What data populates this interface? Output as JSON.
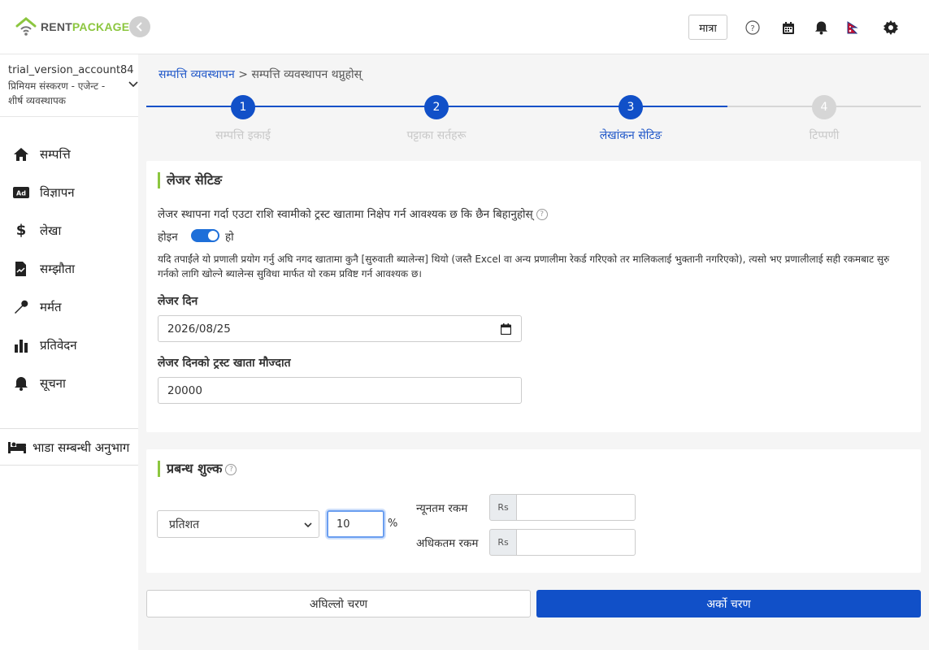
{
  "brand": {
    "part1": "RENT",
    "part2": "PACKAGE"
  },
  "account": {
    "name": "trial_version_account84",
    "plan": "प्रिमियम संस्करण - एजेन्ट - शीर्ष व्यवस्थापक"
  },
  "sidebar": {
    "items": [
      {
        "label": "सम्पत्ति",
        "icon": "home-icon"
      },
      {
        "label": "विज्ञापन",
        "icon": "ad-icon"
      },
      {
        "label": "लेखा",
        "icon": "dollar-icon"
      },
      {
        "label": "सम्झौता",
        "icon": "contract-icon"
      },
      {
        "label": "मर्मत",
        "icon": "wrench-icon"
      },
      {
        "label": "प्रतिवेदन",
        "icon": "bar-chart-icon"
      },
      {
        "label": "सूचना",
        "icon": "bell-icon"
      }
    ],
    "rental_section": "भाडा सम्बन्धी अनुभाग"
  },
  "topbar": {
    "matra_label": "मात्रा",
    "icons": [
      "help-icon",
      "calendar-icon",
      "bell-icon",
      "nepal-flag-icon",
      "gear-icon"
    ]
  },
  "breadcrumb": {
    "parent": "सम्पत्ति व्यवस्थापन",
    "separator": ">",
    "current": "सम्पत्ति व्यवस्थापन थप्नुहोस्"
  },
  "steps": [
    {
      "number": "1",
      "label": "सम्पत्ति इकाई",
      "state": "done"
    },
    {
      "number": "2",
      "label": "पट्टाका सर्तहरू",
      "state": "done"
    },
    {
      "number": "3",
      "label": "लेखांकन सेटिङ",
      "state": "active"
    },
    {
      "number": "4",
      "label": "टिप्पणी",
      "state": "pending"
    }
  ],
  "ledger": {
    "title": "लेजर सेटिङ",
    "question": "लेजर स्थापना गर्दा एउटा राशि स्वामीको ट्रस्ट खातामा निक्षेप गर्न आवश्यक छ कि छैन बिहानुहोस्",
    "toggle_no": "होइन",
    "toggle_yes": "हो",
    "toggle_on": true,
    "note": "यदि तपाईंले यो प्रणाली प्रयोग गर्नु अघि नगद खातामा कुनै [सुरुवाती ब्यालेन्स] थियो (जस्तै Excel वा अन्य प्रणालीमा रेकर्ड गरिएको तर मालिकलाई भुक्तानी नगरिएको), त्यसो भए प्रणालीलाई सही रकमबाट सुरु गर्नको लागि खोल्ने ब्यालेन्स सुविधा मार्फत यो रकम प्रविष्ट गर्न आवश्यक छ।",
    "date_label": "लेजर दिन",
    "date_value": "2026/08/25",
    "balance_label": "लेजर दिनको ट्रस्ट खाता मौज्दात",
    "balance_value": "20000"
  },
  "fee": {
    "title": "प्रबन्ध शुल्क",
    "type_value": "प्रतिशत",
    "percent_value": "10",
    "percent_sign": "%",
    "min_label": "न्यूनतम रकम",
    "max_label": "अधिकतम रकम",
    "currency": "Rs"
  },
  "buttons": {
    "prev": "अघिल्लो चरण",
    "next": "अर्को चरण"
  },
  "colors": {
    "primary": "#1150c8",
    "accent_green": "#8cc63f",
    "pending": "#d6d6d6"
  }
}
